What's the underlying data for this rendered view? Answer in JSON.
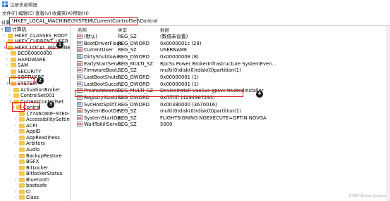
{
  "window": {
    "title": "注册表编辑器"
  },
  "menu": [
    "文件(F)",
    "编辑(E)",
    "查看(V)",
    "收藏夹(A)",
    "帮助(H)"
  ],
  "address": {
    "label": "计算机",
    "path": "\\HKEY_LOCAL_MACHINE\\SYSTEM\\CurrentControlSet\\Control"
  },
  "tree": [
    {
      "label": "计算机",
      "expander": "v",
      "icon": "computer"
    },
    {
      "label": "HKEY_CLASSES_ROOT",
      "expander": ">",
      "icon": "folder"
    },
    {
      "label": "HKEY_CURRENT_USER",
      "expander": ">",
      "icon": "folder"
    },
    {
      "label": "HKEY_LOCAL_MACHINE",
      "expander": "v",
      "icon": "folder"
    },
    {
      "label": "BCD00000000",
      "expander": ">",
      "icon": "folder"
    },
    {
      "label": "HARDWARE",
      "expander": ">",
      "icon": "folder"
    },
    {
      "label": "SAM",
      "expander": ">",
      "icon": "folder"
    },
    {
      "label": "SECURITY",
      "expander": "",
      "icon": "folder"
    },
    {
      "label": "SOFTWARE",
      "expander": ">",
      "icon": "folder"
    },
    {
      "label": "SYSTEM",
      "expander": "v",
      "icon": "folder"
    },
    {
      "label": "ActivationBroker",
      "expander": ">",
      "icon": "folder"
    },
    {
      "label": "ControlSet001",
      "expander": ">",
      "icon": "folder"
    },
    {
      "label": "CurrentControlSet",
      "expander": "v",
      "icon": "folder"
    },
    {
      "label": "Control",
      "expander": "v",
      "icon": "folder"
    },
    {
      "label": "{7746D80F-97E0-4E",
      "expander": "",
      "icon": "folder"
    },
    {
      "label": "AccessibilitySetting",
      "expander": ">",
      "icon": "folder"
    },
    {
      "label": "ACPI",
      "expander": ">",
      "icon": "folder"
    },
    {
      "label": "AppID",
      "expander": ">",
      "icon": "folder"
    },
    {
      "label": "AppReadiness",
      "expander": "",
      "icon": "folder"
    },
    {
      "label": "Arbiters",
      "expander": ">",
      "icon": "folder"
    },
    {
      "label": "Audio",
      "expander": "",
      "icon": "folder"
    },
    {
      "label": "BackupRestore",
      "expander": ">",
      "icon": "folder"
    },
    {
      "label": "BGFX",
      "expander": "",
      "icon": "folder"
    },
    {
      "label": "BitLocker",
      "expander": "",
      "icon": "folder"
    },
    {
      "label": "BitlockerStatus",
      "expander": "",
      "icon": "folder"
    },
    {
      "label": "Bluetooth",
      "expander": ">",
      "icon": "folder"
    },
    {
      "label": "bootsafe",
      "expander": "",
      "icon": "folder"
    },
    {
      "label": "CI",
      "expander": ">",
      "icon": "folder"
    },
    {
      "label": "Class",
      "expander": ">",
      "icon": "folder"
    }
  ],
  "columns": {
    "name": "名称",
    "type": "类型",
    "data": "数据"
  },
  "values": [
    {
      "name": "(默认)",
      "type": "REG_SZ",
      "data": "(数值未设置)",
      "icon": "ab"
    },
    {
      "name": "BootDriverFlags",
      "type": "REG_DWORD",
      "data": "0x0000001c (28)",
      "icon": "bin"
    },
    {
      "name": "CurrentUser",
      "type": "REG_SZ",
      "data": "USERNAME",
      "icon": "ab"
    },
    {
      "name": "DirtyShutdown...",
      "type": "REG_DWORD",
      "data": "0x00000008 (8)",
      "icon": "bin"
    },
    {
      "name": "EarlyStartServi...",
      "type": "REG_MULTI_SZ",
      "data": "RpcSs Power BrokerInfrastructure SystemEven...",
      "icon": "ab"
    },
    {
      "name": "FirmwareBoot...",
      "type": "REG_SZ",
      "data": "multi(0)disk(0)rdisk(0)partition(1)",
      "icon": "ab"
    },
    {
      "name": "LastBootShutd...",
      "type": "REG_DWORD",
      "data": "0x00000001 (1)",
      "icon": "bin"
    },
    {
      "name": "LastBootSucce...",
      "type": "REG_DWORD",
      "data": "0x00000001 (1)",
      "icon": "bin"
    },
    {
      "name": "PreshutdownO...",
      "type": "REG_MULTI_SZ",
      "data": "DeviceInstall UsoSvc gpsvc trustedinstaller",
      "icon": "ab"
    },
    {
      "name": "RegistrySizeLi...",
      "type": "REG_DWORD",
      "data": "0xffffffff (4294967295)",
      "icon": "bin"
    },
    {
      "name": "SvcHostSplitT...",
      "type": "REG_DWORD",
      "data": "0x00380000 (3670016)",
      "icon": "bin"
    },
    {
      "name": "SystemBootDe...",
      "type": "REG_SZ",
      "data": "multi(0)disk(0)rdisk(0)partition(1)",
      "icon": "ab"
    },
    {
      "name": "SystemStartOp...",
      "type": "REG_SZ",
      "data": " FLIGHTSIGNING  NOEXECUTE=OPTIN  NOVGA",
      "icon": "ab"
    },
    {
      "name": "WaitToKillServi...",
      "type": "REG_SZ",
      "data": "5000",
      "icon": "ab"
    }
  ],
  "badges": [
    "1",
    "2",
    "3",
    "4"
  ],
  "watermark": "CSDN @huanghuang"
}
